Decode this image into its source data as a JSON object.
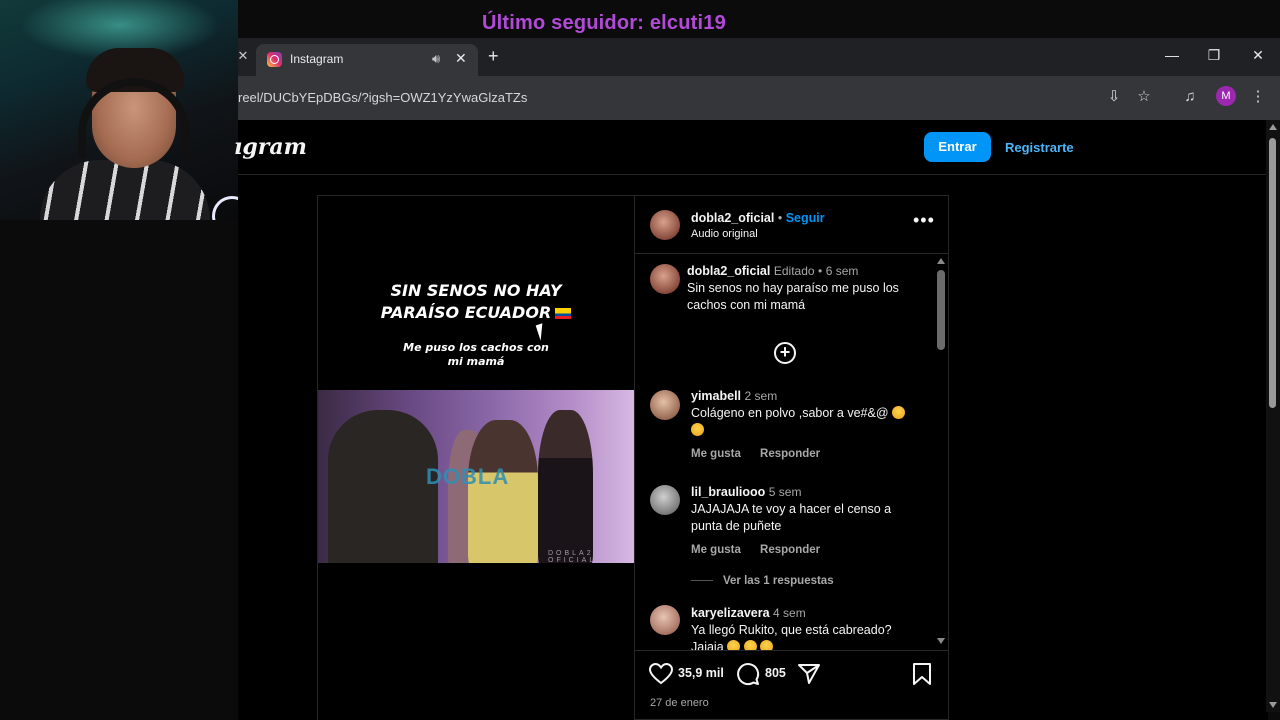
{
  "overlay": {
    "follower_banner": "Último seguidor: elcuti19"
  },
  "browser": {
    "tab_title": "Instagram",
    "url": "reel/DUCbYEpDBGs/?igsh=OWZ1YzYwaGlzaTZs",
    "profile_initial": "M"
  },
  "instagram": {
    "logo_text": "ıgram",
    "login_label": "Entrar",
    "signup_label": "Registrarte"
  },
  "post": {
    "media_title_line1": "SIN SENOS NO HAY",
    "media_title_line2": "PARAÍSO ECUADOR",
    "media_subtitle_line1": "Me puso los cachos con",
    "media_subtitle_line2": "mi mamá",
    "watermark": "DOBLA",
    "watermark_small": "DOBLA2 OFICIAL",
    "author": "dobla2_oficial",
    "follow_label": "Seguir",
    "audio_label": "Audio original",
    "caption": {
      "user": "dobla2_oficial",
      "edited": "Editado",
      "time": "6 sem",
      "text": "Sin senos no hay paraíso me puso los cachos con mi mamá"
    },
    "comments": [
      {
        "user": "yimabell",
        "time": "2 sem",
        "text": "Colágeno en polvo ,sabor a ve#&@",
        "like": "Me gusta",
        "reply": "Responder"
      },
      {
        "user": "lil_brauliooo",
        "time": "5 sem",
        "text": "JAJAJAJA te voy a hacer el censo a punta de puñete",
        "like": "Me gusta",
        "reply": "Responder"
      },
      {
        "user": "karyelizavera",
        "time": "4 sem",
        "text": "Ya llegó Rukito, que está cabreado? Jajaja"
      }
    ],
    "view_replies": "Ver las 1 respuestas",
    "likes": "35,9 mil",
    "comment_count": "805",
    "date": "27 de enero"
  }
}
